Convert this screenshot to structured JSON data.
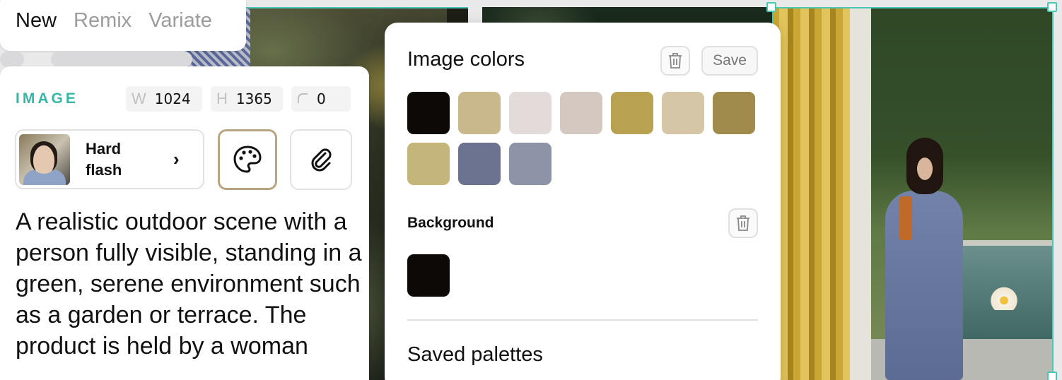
{
  "tabs": {
    "items": [
      "New",
      "Remix",
      "Variate"
    ],
    "active_index": 0
  },
  "image_settings": {
    "section_label": "IMAGE",
    "width_prefix": "W",
    "width_value": "1024",
    "height_prefix": "H",
    "height_value": "1365",
    "radius_value": "0",
    "style_name": "Hard flash",
    "style_chevron": "›",
    "palette_icon": "palette-icon",
    "attach_icon": "paperclip-icon",
    "prompt": "A realistic outdoor scene with a person fully visible, standing in a green, serene environment such as a garden or terrace. The product is held by a woman"
  },
  "colors_popover": {
    "title": "Image colors",
    "save_label": "Save",
    "image_colors": [
      "#0d0906",
      "#c8b88c",
      "#e3dbda",
      "#d5c8c0",
      "#b9a152",
      "#d5c6a7",
      "#a08b4c",
      "#c4b57b",
      "#6b7390",
      "#8e94a8"
    ],
    "background_label": "Background",
    "background_colors": [
      "#0d0906"
    ],
    "saved_palettes_title": "Saved palettes"
  },
  "accent_color": "#35b9a6"
}
